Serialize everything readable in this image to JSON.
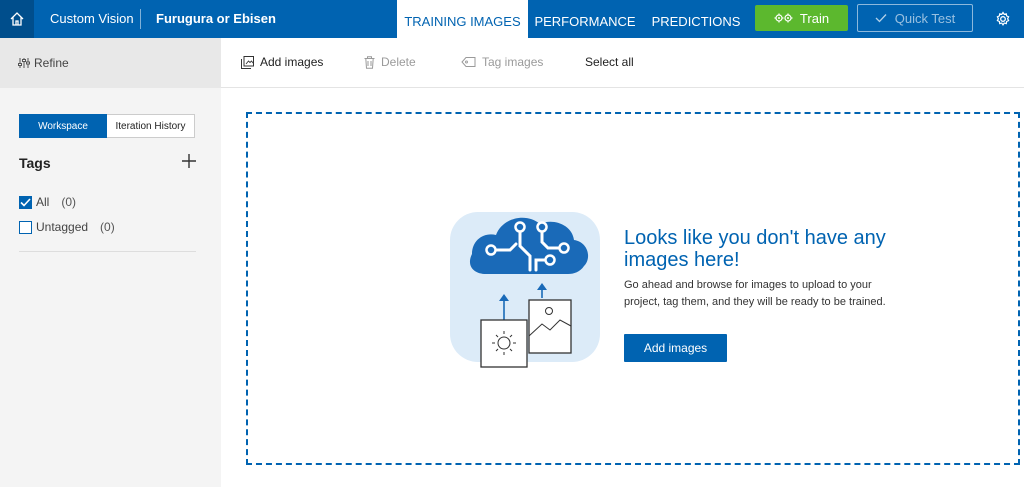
{
  "header": {
    "app_title": "Custom Vision",
    "project_name": "Furugura or Ebisen",
    "tabs": [
      {
        "label": "TRAINING IMAGES",
        "active": true
      },
      {
        "label": "PERFORMANCE",
        "active": false
      },
      {
        "label": "PREDICTIONS",
        "active": false
      }
    ],
    "train_label": "Train",
    "quick_test_label": "Quick Test",
    "accent_color": "#0063b1",
    "train_color": "#5cb82e"
  },
  "sidebar": {
    "refine_label": "Refine",
    "segments": [
      {
        "label": "Workspace",
        "active": true
      },
      {
        "label": "Iteration History",
        "active": false
      }
    ],
    "tags_heading": "Tags",
    "tags": [
      {
        "label": "All",
        "count": "(0)",
        "checked": true
      },
      {
        "label": "Untagged",
        "count": "(0)",
        "checked": false
      }
    ]
  },
  "toolbar": {
    "add_images_label": "Add images",
    "delete_label": "Delete",
    "tag_images_label": "Tag images",
    "select_all_label": "Select all"
  },
  "empty_state": {
    "title": "Looks like you don't have any images here!",
    "description": "Go ahead and browse for images to upload to your project, tag them, and they will be ready to be trained.",
    "button_label": "Add images"
  },
  "icons": {
    "home": "home-icon",
    "train": "gears-icon",
    "quick_test": "checkmark-icon",
    "settings": "gear-icon",
    "refine": "sliders-icon",
    "add_tag": "plus-icon",
    "add_images": "image-stack-icon",
    "delete": "trash-icon",
    "tag_images": "tag-icon",
    "illustration": "cloud-upload-images-illustration"
  }
}
